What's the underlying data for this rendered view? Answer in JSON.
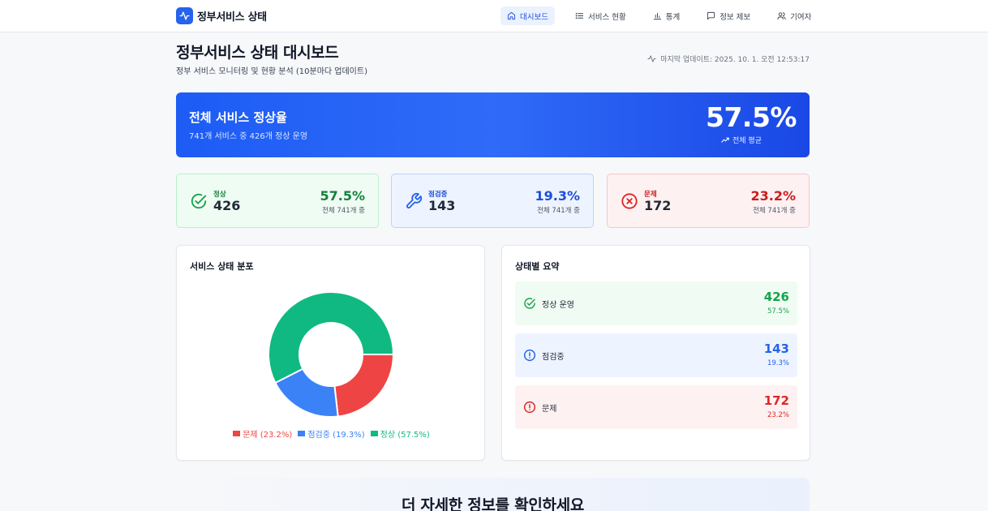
{
  "header": {
    "logo_text": "정부서비스 상태",
    "nav": [
      {
        "label": "대시보드",
        "icon": "home-icon",
        "active": true
      },
      {
        "label": "서비스 현황",
        "icon": "list-icon",
        "active": false
      },
      {
        "label": "통계",
        "icon": "bar-chart-icon",
        "active": false
      },
      {
        "label": "정보 제보",
        "icon": "message-icon",
        "active": false
      },
      {
        "label": "기여자",
        "icon": "users-icon",
        "active": false
      }
    ]
  },
  "page": {
    "title": "정부서비스 상태 대시보드",
    "subtitle": "정부 서비스 모니터링 및 현황 분석 (10분마다 업데이트)",
    "last_update": "마지막 업데이트: 2025. 10. 1. 오전 12:53:17"
  },
  "hero": {
    "title": "전체 서비스 정상율",
    "subtitle": "741개 서비스 중 426개 정상 운영",
    "percent": "57.5%",
    "avg_label": "전체 평균"
  },
  "stats": {
    "normal": {
      "label": "정상",
      "count": "426",
      "percent": "57.5%",
      "total": "전체 741개 중"
    },
    "maintenance": {
      "label": "점검중",
      "count": "143",
      "percent": "19.3%",
      "total": "전체 741개 중"
    },
    "problem": {
      "label": "문제",
      "count": "172",
      "percent": "23.2%",
      "total": "전체 741개 중"
    }
  },
  "distribution": {
    "title": "서비스 상태 분포",
    "legend": [
      "문제 (23.2%)",
      "점검중 (19.3%)",
      "정상 (57.5%)"
    ]
  },
  "chart_data": {
    "type": "pie",
    "categories": [
      "문제",
      "점검중",
      "정상"
    ],
    "values": [
      23.2,
      19.3,
      57.5
    ],
    "colors": [
      "#ef4444",
      "#3b82f6",
      "#10b981"
    ]
  },
  "summary": {
    "title": "상태별 요약",
    "rows": [
      {
        "label": "정상 운영",
        "count": "426",
        "percent": "57.5%"
      },
      {
        "label": "점검중",
        "count": "143",
        "percent": "19.3%"
      },
      {
        "label": "문제",
        "count": "172",
        "percent": "23.2%"
      }
    ]
  },
  "cta": {
    "title": "더 자세한 정보를 확인하세요"
  },
  "colors": {
    "primary": "#2563eb",
    "green": "#16a34a",
    "blue": "#2563eb",
    "red": "#dc2626"
  }
}
